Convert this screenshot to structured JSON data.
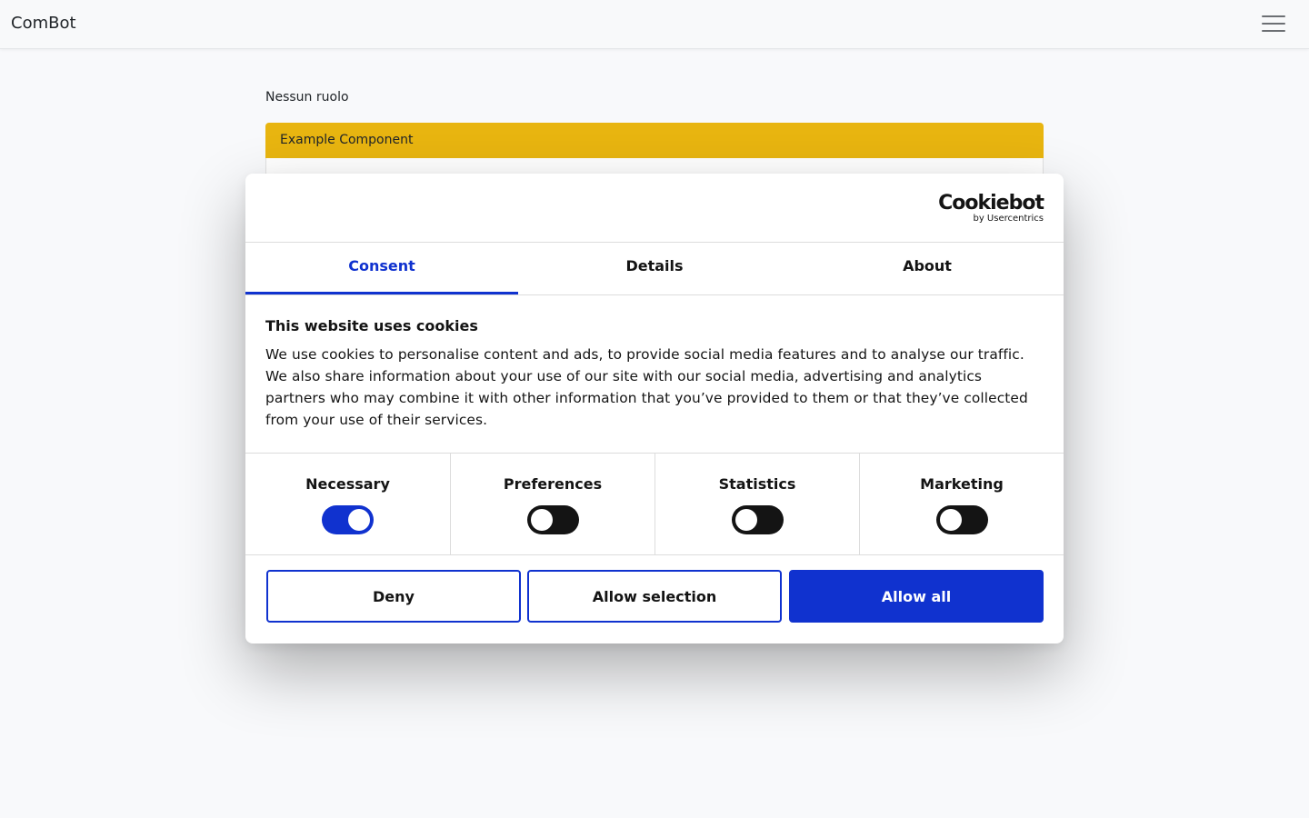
{
  "navbar": {
    "brand": "ComBot",
    "menu_icon": "hamburger-menu-icon"
  },
  "main": {
    "role_text": "Nessun ruolo",
    "card_header": "Example Component",
    "card_header_color": "#e8b510"
  },
  "cookie_dialog": {
    "logo": {
      "main": "Cookiebot",
      "sub": "by Usercentrics"
    },
    "tabs": [
      {
        "label": "Consent",
        "active": true
      },
      {
        "label": "Details",
        "active": false
      },
      {
        "label": "About",
        "active": false
      }
    ],
    "heading": "This website uses cookies",
    "body": "We use cookies to personalise content and ads, to provide social media features and to analyse our traffic. We also share information about your use of our site with our social media, advertising and analytics partners who may combine it with other information that you’ve provided to them or that they’ve collected from your use of their services.",
    "categories": [
      {
        "label": "Necessary",
        "enabled": true
      },
      {
        "label": "Preferences",
        "enabled": false
      },
      {
        "label": "Statistics",
        "enabled": false
      },
      {
        "label": "Marketing",
        "enabled": false
      }
    ],
    "buttons": {
      "deny": "Deny",
      "allow_selection": "Allow selection",
      "allow_all": "Allow all"
    },
    "accent_color": "#1032cf"
  }
}
